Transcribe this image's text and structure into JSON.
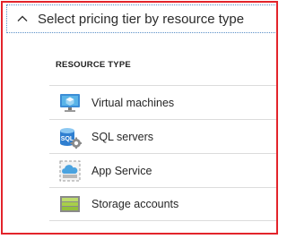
{
  "section": {
    "title": "Select pricing tier by resource type",
    "expand_icon": "chevron-up-icon"
  },
  "table": {
    "column_header": "RESOURCE TYPE",
    "rows": [
      {
        "label": "Virtual machines",
        "icon": "virtual-machine-icon"
      },
      {
        "label": "SQL servers",
        "icon": "sql-server-icon"
      },
      {
        "label": "App Service",
        "icon": "app-service-icon"
      },
      {
        "label": "Storage accounts",
        "icon": "storage-account-icon"
      }
    ]
  },
  "colors": {
    "frame_border": "#e3242b",
    "focus_outline": "#5a8fc8",
    "row_divider": "#dcdcdc"
  }
}
